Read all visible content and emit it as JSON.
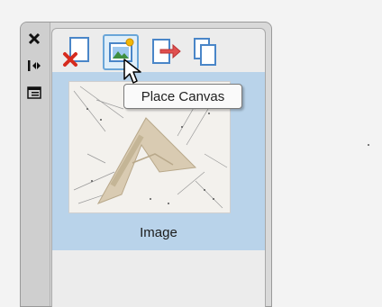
{
  "side_strip": {
    "close_icon": "close-icon",
    "auto_hide_icon": "arrow-collapse-icon",
    "panel_menu_icon": "panel-menu-icon"
  },
  "toolbar": {
    "buttons": [
      {
        "name": "delete-canvas",
        "icon": "delete-page-icon"
      },
      {
        "name": "place-canvas",
        "icon": "place-image-icon",
        "active": true
      },
      {
        "name": "move-to-canvas",
        "icon": "page-arrow-icon"
      },
      {
        "name": "duplicate-canvas",
        "icon": "duplicate-pages-icon"
      }
    ]
  },
  "tooltip": {
    "text": "Place Canvas"
  },
  "canvas_list": {
    "items": [
      {
        "label": "Image",
        "selected": true
      }
    ]
  },
  "colors": {
    "selection": "#b9d3ea",
    "active_border": "#6aa6d8",
    "delete_red": "#d62b1e",
    "arrow_red": "#e05050",
    "page_blue": "#4a86c8"
  }
}
